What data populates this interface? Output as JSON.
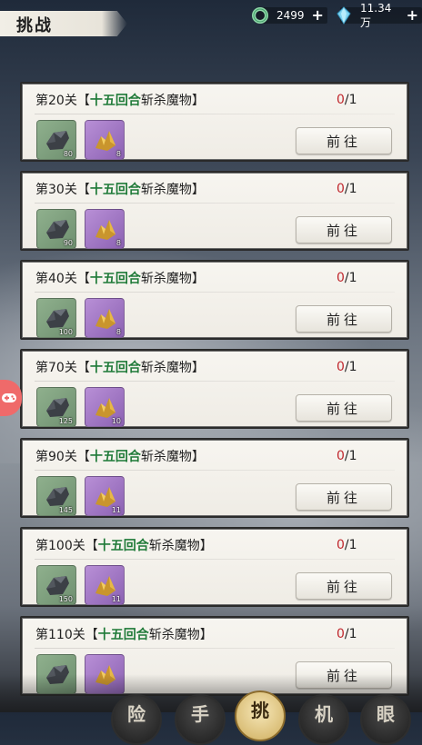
{
  "header": {
    "title": "挑战",
    "jade_amount": "2499",
    "gem_amount": "11.34万",
    "plus_label": "+"
  },
  "colors": {
    "highlight_green": "#1f7a38",
    "progress_red": "#c0272d"
  },
  "stages": [
    {
      "prefix": "第20关",
      "open": "【",
      "highlight": "十五回合",
      "rest": "斩杀魔物",
      "close": "】",
      "progress_current": "0",
      "progress_total": "/1",
      "item1_count": "80",
      "item2_count": "8",
      "button_label": "前往"
    },
    {
      "prefix": "第30关",
      "open": "【",
      "highlight": "十五回合",
      "rest": "斩杀魔物",
      "close": "】",
      "progress_current": "0",
      "progress_total": "/1",
      "item1_count": "90",
      "item2_count": "8",
      "button_label": "前往"
    },
    {
      "prefix": "第40关",
      "open": "【",
      "highlight": "十五回合",
      "rest": "斩杀魔物",
      "close": "】",
      "progress_current": "0",
      "progress_total": "/1",
      "item1_count": "100",
      "item2_count": "8",
      "button_label": "前往"
    },
    {
      "prefix": "第70关",
      "open": "【",
      "highlight": "十五回合",
      "rest": "斩杀魔物",
      "close": "】",
      "progress_current": "0",
      "progress_total": "/1",
      "item1_count": "125",
      "item2_count": "10",
      "button_label": "前往"
    },
    {
      "prefix": "第90关",
      "open": "【",
      "highlight": "十五回合",
      "rest": "斩杀魔物",
      "close": "】",
      "progress_current": "0",
      "progress_total": "/1",
      "item1_count": "145",
      "item2_count": "11",
      "button_label": "前往"
    },
    {
      "prefix": "第100关",
      "open": "【",
      "highlight": "十五回合",
      "rest": "斩杀魔物",
      "close": "】",
      "progress_current": "0",
      "progress_total": "/1",
      "item1_count": "150",
      "item2_count": "11",
      "button_label": "前往"
    },
    {
      "prefix": "第110关",
      "open": "【",
      "highlight": "十五回合",
      "rest": "斩杀魔物",
      "close": "】",
      "progress_current": "0",
      "progress_total": "/1",
      "item1_count": "",
      "item2_count": "",
      "button_label": "前往"
    }
  ],
  "bottom_nav": [
    {
      "label": "险",
      "icon": "adventure-icon",
      "active": false
    },
    {
      "label": "手",
      "icon": "hand-icon",
      "active": false
    },
    {
      "label": "挑",
      "icon": "challenge-icon",
      "active": true
    },
    {
      "label": "机",
      "icon": "machine-icon",
      "active": false
    },
    {
      "label": "眼",
      "icon": "eye-icon",
      "active": false
    }
  ]
}
